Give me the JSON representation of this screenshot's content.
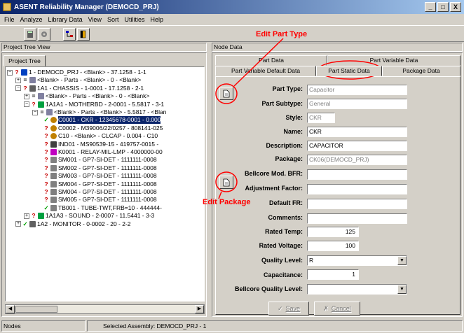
{
  "window": {
    "title": "ASENT Reliability Manager (DEMOCD_PRJ)",
    "min": "_",
    "max": "□",
    "close": "X"
  },
  "menu": [
    "File",
    "Analyze",
    "Library Data",
    "View",
    "Sort",
    "Utilities",
    "Help"
  ],
  "panels": {
    "left_header": "Project Tree View",
    "right_header": "Node Data",
    "left_tab": "Project Tree"
  },
  "tree": [
    {
      "prefix": "⊟",
      "mark": "?",
      "mark_class": "q",
      "icon": "project-icon",
      "text": "1 - DEMOCD_PRJ - <Blank> - 37.1258 - 1-1"
    },
    {
      "prefix": "⊞",
      "mark": "=",
      "mark_class": "",
      "icon": "parts-icon",
      "text": "<Blank> - Parts - <Blank> - 0 - <Blank>"
    },
    {
      "prefix": "⊟",
      "mark": "?",
      "mark_class": "q",
      "icon": "chassis-icon",
      "text": "1A1 - CHASSIS - 1-0001 - 17.1258 - 2-1"
    },
    {
      "prefix": "⊞",
      "mark": "=",
      "mark_class": "",
      "icon": "parts-icon",
      "text": "<Blank> - Parts - <Blank> - 0 - <Blank>"
    },
    {
      "prefix": "⊟",
      "mark": "?",
      "mark_class": "q",
      "icon": "board-icon",
      "text": "1A1A1 - MOTHERBD - 2-0001 - 5.5817 - 3-1"
    },
    {
      "prefix": "⊟",
      "mark": "=",
      "mark_class": "",
      "icon": "parts-icon",
      "text": "<Blank> - Parts - <Blank> - 5.5817 - <Blan"
    },
    {
      "prefix": "",
      "mark": "✓",
      "mark_class": "ck",
      "icon": "capacitor-icon",
      "text": "C0001 - CKR - 12345678-0001 - 0.000",
      "selected": true
    },
    {
      "prefix": "",
      "mark": "?",
      "mark_class": "q",
      "icon": "capacitor-icon",
      "text": "C0002 - M39006/22/0257 - 808141-025"
    },
    {
      "prefix": "",
      "mark": "?",
      "mark_class": "q",
      "icon": "capacitor-icon",
      "text": "C10 - <Blank> - CLCAP - 0.004 - C10"
    },
    {
      "prefix": "",
      "mark": "?",
      "mark_class": "q",
      "icon": "inductor-icon",
      "text": "IND01 - MS90539-15 - 419757-0015 -"
    },
    {
      "prefix": "",
      "mark": "?",
      "mark_class": "q",
      "icon": "relay-icon",
      "text": "K0001 - RELAY-MIL-LMP - 4000000-00"
    },
    {
      "prefix": "",
      "mark": "?",
      "mark_class": "q",
      "icon": "switch-icon",
      "text": "SM001 - GP7-SI-DET - 1111111-0008"
    },
    {
      "prefix": "",
      "mark": "?",
      "mark_class": "q",
      "icon": "switch-icon",
      "text": "SM002 - GP7-SI-DET - 1111111-0008"
    },
    {
      "prefix": "",
      "mark": "?",
      "mark_class": "q",
      "icon": "switch-icon",
      "text": "SM003 - GP7-SI-DET - 1111111-0008"
    },
    {
      "prefix": "",
      "mark": "?",
      "mark_class": "q",
      "icon": "switch-icon",
      "text": "SM004 - GP7-SI-DET - 1111111-0008"
    },
    {
      "prefix": "",
      "mark": "?",
      "mark_class": "q",
      "icon": "switch-icon",
      "text": "SM004 - GP7-SI-DET - 1111111-0008"
    },
    {
      "prefix": "",
      "mark": "?",
      "mark_class": "q",
      "icon": "switch-icon",
      "text": "SM005 - GP7-SI-DET - 1111111-0008"
    },
    {
      "prefix": "",
      "mark": "✓",
      "mark_class": "ck",
      "icon": "tube-icon",
      "text": "TB001 - TUBE-TWT,FRB=10 - 444444-"
    },
    {
      "prefix": "⊞",
      "mark": "?",
      "mark_class": "q",
      "icon": "board-icon",
      "text": "1A1A3 - SOUND - 2-0007 - 11.5441 - 3-3"
    },
    {
      "prefix": "⊞",
      "mark": "✓",
      "mark_class": "ck",
      "icon": "chassis-icon",
      "text": "1A2 - MONITOR - 0-0002 - 20 - 2-2"
    }
  ],
  "tabs": {
    "row1": [
      "Part Data",
      "Part Variable Data"
    ],
    "row2": [
      "Part Variable Default Data",
      "Part Static Data",
      "Package Data"
    ],
    "active": "Part Static Data"
  },
  "form": {
    "part_type": {
      "label": "Part Type:",
      "value": "Capacitor"
    },
    "part_subtype": {
      "label": "Part Subtype:",
      "value": "General"
    },
    "style": {
      "label": "Style:",
      "value": "CKR"
    },
    "name": {
      "label": "Name:",
      "value": "CKR"
    },
    "description": {
      "label": "Description:",
      "value": "CAPACITOR"
    },
    "package": {
      "label": "Package:",
      "value": "CK06(DEMOCD_PRJ)"
    },
    "bellcore_bfr": {
      "label": "Bellcore Mod. BFR:",
      "value": ""
    },
    "adjustment_factor": {
      "label": "Adjustment Factor:",
      "value": ""
    },
    "default_fr": {
      "label": "Default FR:",
      "value": ""
    },
    "comments": {
      "label": "Comments:",
      "value": ""
    },
    "rated_temp": {
      "label": "Rated Temp:",
      "value": "125"
    },
    "rated_voltage": {
      "label": "Rated Voltage:",
      "value": "100"
    },
    "quality_level": {
      "label": "Quality Level:",
      "value": "R"
    },
    "capacitance": {
      "label": "Capacitance:",
      "value": "1"
    },
    "bellcore_quality": {
      "label": "Bellcore Quality Level:",
      "value": ""
    }
  },
  "buttons": {
    "save": "Save",
    "cancel": "Cancel"
  },
  "annotations": {
    "edit_part_type": "Edit Part Type",
    "edit_package": "Edit Package",
    "color": "#ff0000"
  },
  "status": {
    "left": "Nodes",
    "right": "Selected Assembly: DEMOCD_PRJ - 1"
  }
}
